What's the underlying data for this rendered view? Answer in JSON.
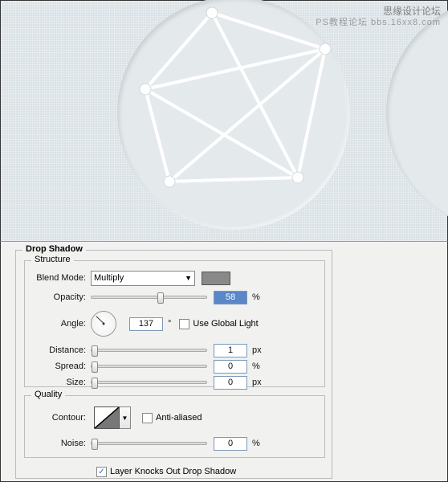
{
  "watermark": {
    "line1": "思缘设计论坛",
    "line2": "PS教程论坛 bbs.16xx8.com"
  },
  "panel": {
    "title": "Drop Shadow",
    "structure": {
      "legend": "Structure",
      "blend_mode_label": "Blend Mode:",
      "blend_mode_value": "Multiply",
      "color": "#898989",
      "opacity_label": "Opacity:",
      "opacity_value": "58",
      "opacity_unit": "%",
      "angle_label": "Angle:",
      "angle_value": "137",
      "angle_unit": "°",
      "global_light_label": "Use Global Light",
      "global_light_checked": false,
      "distance_label": "Distance:",
      "distance_value": "1",
      "distance_unit": "px",
      "spread_label": "Spread:",
      "spread_value": "0",
      "spread_unit": "%",
      "size_label": "Size:",
      "size_value": "0",
      "size_unit": "px"
    },
    "quality": {
      "legend": "Quality",
      "contour_label": "Contour:",
      "anti_aliased_label": "Anti-aliased",
      "anti_aliased_checked": false,
      "noise_label": "Noise:",
      "noise_value": "0",
      "noise_unit": "%"
    },
    "knockout": {
      "label": "Layer Knocks Out Drop Shadow",
      "checked": true,
      "checkmark": "✓"
    }
  }
}
